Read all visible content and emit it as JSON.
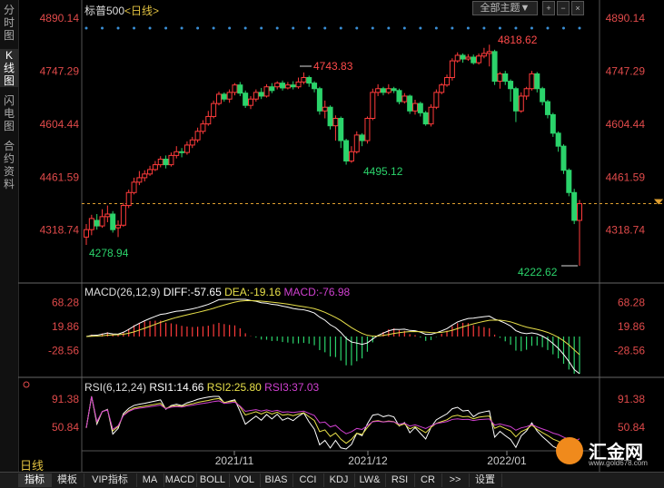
{
  "header": {
    "symbol": "标普500",
    "period_tag": "<日线>",
    "theme_button": "全部主题▼",
    "ctl_plus": "+",
    "ctl_minus": "−",
    "ctl_close": "×"
  },
  "sidebar": {
    "tabs": [
      "分时图",
      "K线图",
      "闪电图",
      "合约资料"
    ]
  },
  "price_axis": {
    "ticks": [
      "4890.14",
      "4747.29",
      "4604.44",
      "4461.59",
      "4318.74"
    ]
  },
  "price_annotations": {
    "high1": "4743.83",
    "low1": "4495.12",
    "high2": "4818.62",
    "low_start": "4278.94",
    "low_end": "4222.62"
  },
  "macd": {
    "label": "MACD(26,12,9)",
    "diff": "DIFF:-57.65",
    "dea": "DEA:-19.16",
    "macd": "MACD:-76.98",
    "ticks": [
      "68.28",
      "19.86",
      "-28.56"
    ]
  },
  "rsi": {
    "label": "RSI(6,12,24)",
    "rsi1": "RSI1:14.66",
    "rsi2": "RSI2:25.80",
    "rsi3": "RSI3:37.03",
    "ticks": [
      "91.38",
      "50.84"
    ]
  },
  "time_axis": [
    "2021/11",
    "2021/12",
    "2022/01"
  ],
  "period_label": "日线",
  "bottom_tabs": [
    "指标",
    "模板",
    "VIP指标",
    "MA",
    "MACD",
    "BOLL",
    "VOL",
    "BIAS",
    "CCI",
    "KDJ",
    "LW&",
    "RSI",
    "CR",
    ">>",
    "设置"
  ],
  "logo": {
    "name": "汇金网",
    "url": "www.gold678.com"
  },
  "colors": {
    "up": "#ff3b3b",
    "down": "#2bd36b",
    "diff": "#ffffff",
    "dea": "#e8e04a",
    "rsi1": "#ffffff",
    "rsi2": "#e8e04a",
    "rsi3": "#d040d0",
    "price_tick": "#e04a4a"
  },
  "chart_data": {
    "type": "candlestick",
    "ylim": [
      4222.62,
      4890.14
    ],
    "candles": [
      [
        4300,
        4320,
        4278.94,
        4335
      ],
      [
        4320,
        4350,
        4305,
        4360
      ],
      [
        4345,
        4330,
        4320,
        4362
      ],
      [
        4330,
        4355,
        4325,
        4375
      ],
      [
        4355,
        4362,
        4340,
        4385
      ],
      [
        4362,
        4320,
        4312,
        4370
      ],
      [
        4325,
        4332,
        4300,
        4345
      ],
      [
        4332,
        4385,
        4328,
        4392
      ],
      [
        4385,
        4420,
        4378,
        4428
      ],
      [
        4420,
        4448,
        4415,
        4460
      ],
      [
        4448,
        4460,
        4440,
        4478
      ],
      [
        4460,
        4470,
        4450,
        4480
      ],
      [
        4470,
        4482,
        4465,
        4492
      ],
      [
        4482,
        4495,
        4478,
        4505
      ],
      [
        4495,
        4510,
        4488,
        4518
      ],
      [
        4510,
        4495,
        4485,
        4520
      ],
      [
        4495,
        4520,
        4490,
        4528
      ],
      [
        4520,
        4530,
        4512,
        4545
      ],
      [
        4530,
        4528,
        4515,
        4540
      ],
      [
        4528,
        4548,
        4522,
        4558
      ],
      [
        4548,
        4562,
        4540,
        4570
      ],
      [
        4562,
        4585,
        4555,
        4595
      ],
      [
        4585,
        4605,
        4578,
        4615
      ],
      [
        4605,
        4625,
        4600,
        4640
      ],
      [
        4625,
        4660,
        4620,
        4668
      ],
      [
        4660,
        4685,
        4655,
        4692
      ],
      [
        4685,
        4672,
        4665,
        4690
      ],
      [
        4672,
        4690,
        4662,
        4698
      ],
      [
        4690,
        4710,
        4682,
        4715
      ],
      [
        4710,
        4688,
        4680,
        4718
      ],
      [
        4688,
        4655,
        4648,
        4695
      ],
      [
        4655,
        4672,
        4645,
        4680
      ],
      [
        4672,
        4690,
        4665,
        4698
      ],
      [
        4690,
        4680,
        4672,
        4702
      ],
      [
        4680,
        4705,
        4676,
        4712
      ],
      [
        4705,
        4695,
        4688,
        4715
      ],
      [
        4705,
        4715,
        4698,
        4720
      ],
      [
        4715,
        4702,
        4695,
        4722
      ],
      [
        4702,
        4710,
        4698,
        4718
      ],
      [
        4710,
        4705,
        4698,
        4720
      ],
      [
        4705,
        4718,
        4700,
        4730
      ],
      [
        4718,
        4730,
        4712,
        4743.83
      ],
      [
        4730,
        4715,
        4705,
        4735
      ],
      [
        4715,
        4700,
        4690,
        4720
      ],
      [
        4700,
        4640,
        4630,
        4705
      ],
      [
        4640,
        4650,
        4620,
        4668
      ],
      [
        4650,
        4600,
        4590,
        4655
      ],
      [
        4600,
        4620,
        4560,
        4628
      ],
      [
        4620,
        4560,
        4540,
        4625
      ],
      [
        4560,
        4505,
        4495.12,
        4565
      ],
      [
        4505,
        4530,
        4500,
        4545
      ],
      [
        4530,
        4575,
        4525,
        4585
      ],
      [
        4575,
        4560,
        4545,
        4580
      ],
      [
        4560,
        4620,
        4552,
        4625
      ],
      [
        4620,
        4690,
        4615,
        4700
      ],
      [
        4690,
        4700,
        4680,
        4712
      ],
      [
        4700,
        4690,
        4682,
        4705
      ],
      [
        4690,
        4700,
        4685,
        4712
      ],
      [
        4700,
        4695,
        4688,
        4705
      ],
      [
        4695,
        4665,
        4658,
        4700
      ],
      [
        4665,
        4680,
        4660,
        4688
      ],
      [
        4680,
        4640,
        4632,
        4684
      ],
      [
        4640,
        4660,
        4630,
        4670
      ],
      [
        4660,
        4635,
        4625,
        4665
      ],
      [
        4635,
        4605,
        4600,
        4640
      ],
      [
        4605,
        4650,
        4598,
        4658
      ],
      [
        4650,
        4690,
        4645,
        4698
      ],
      [
        4690,
        4710,
        4685,
        4715
      ],
      [
        4710,
        4730,
        4705,
        4738
      ],
      [
        4730,
        4775,
        4722,
        4782
      ],
      [
        4775,
        4790,
        4770,
        4798
      ],
      [
        4790,
        4780,
        4770,
        4795
      ],
      [
        4780,
        4785,
        4775,
        4793
      ],
      [
        4785,
        4770,
        4765,
        4792
      ],
      [
        4770,
        4788,
        4765,
        4795
      ],
      [
        4788,
        4795,
        4782,
        4810
      ],
      [
        4795,
        4800,
        4760,
        4818.62
      ],
      [
        4800,
        4720,
        4710,
        4805
      ],
      [
        4720,
        4740,
        4700,
        4745
      ],
      [
        4740,
        4720,
        4710,
        4748
      ],
      [
        4720,
        4700,
        4665,
        4725
      ],
      [
        4700,
        4640,
        4610,
        4705
      ],
      [
        4640,
        4680,
        4635,
        4690
      ],
      [
        4680,
        4700,
        4670,
        4705
      ],
      [
        4700,
        4740,
        4695,
        4748
      ],
      [
        4740,
        4700,
        4690,
        4745
      ],
      [
        4700,
        4665,
        4655,
        4705
      ],
      [
        4665,
        4630,
        4620,
        4670
      ],
      [
        4630,
        4580,
        4570,
        4635
      ],
      [
        4580,
        4545,
        4530,
        4585
      ],
      [
        4545,
        4480,
        4470,
        4550
      ],
      [
        4480,
        4420,
        4410,
        4485
      ],
      [
        4420,
        4345,
        4335,
        4430
      ],
      [
        4345,
        4390,
        4222.62,
        4400
      ]
    ],
    "title": "标普500",
    "x_ticks": [
      "2021/11",
      "2021/12",
      "2022/01"
    ]
  }
}
